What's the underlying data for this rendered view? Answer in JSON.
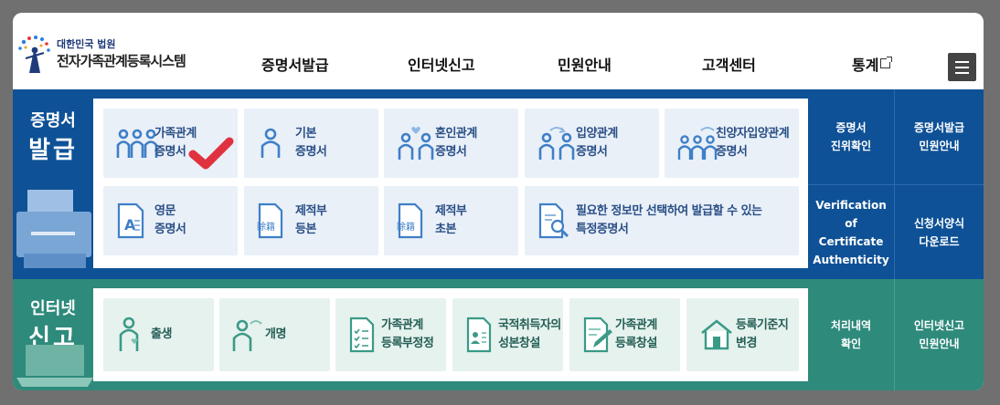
{
  "header": {
    "logo_subtitle": "대한민국 법원",
    "logo_title": "전자가족관계등록시스템",
    "nav": [
      "증명서발급",
      "인터넷신고",
      "민원안내",
      "고객센터",
      "통계"
    ]
  },
  "certificates": {
    "title_small": "증명서",
    "title_big": "발급",
    "cards": [
      {
        "line1": "가족관계",
        "line2": "증명서",
        "icon": "family-icon"
      },
      {
        "line1": "기본",
        "line2": "증명서",
        "icon": "person-icon"
      },
      {
        "line1": "혼인관계",
        "line2": "증명서",
        "icon": "couple-heart-icon"
      },
      {
        "line1": "입양관계",
        "line2": "증명서",
        "icon": "couple-arrows-icon"
      },
      {
        "line1": "친양자입양관계",
        "line2": "증명서",
        "icon": "family-arrows-icon"
      },
      {
        "line1": "영문",
        "line2": "증명서",
        "icon": "english-doc-icon"
      },
      {
        "line1": "제적부",
        "line2": "등본",
        "icon": "register-doc-icon"
      },
      {
        "line1": "제적부",
        "line2": "초본",
        "icon": "register-doc-icon"
      },
      {
        "line1": "필요한 정보만 선택하여 발급할 수 있는",
        "line2": "특정증명서",
        "icon": "search-doc-icon"
      }
    ],
    "side_links": [
      {
        "line1": "증명서",
        "line2": "진위확인"
      },
      {
        "line1": "증명서발급",
        "line2": "민원안내"
      },
      {
        "line1": "Verification of",
        "line2": "Certificate",
        "line3": "Authenticity"
      },
      {
        "line1": "신청서양식",
        "line2": "다운로드"
      }
    ],
    "register_glyph": "除籍"
  },
  "reports": {
    "title_small": "인터넷",
    "title_big": "신고",
    "cards": [
      {
        "line1": "출생",
        "line2": "",
        "icon": "birth-icon"
      },
      {
        "line1": "개명",
        "line2": "",
        "icon": "rename-icon"
      },
      {
        "line1": "가족관계",
        "line2": "등록부정정",
        "icon": "checklist-doc-icon"
      },
      {
        "line1": "국적취득자의",
        "line2": "성본창설",
        "icon": "id-doc-icon"
      },
      {
        "line1": "가족관계",
        "line2": "등록창설",
        "icon": "edit-doc-icon"
      },
      {
        "line1": "등록기준지",
        "line2": "변경",
        "icon": "house-icon"
      }
    ],
    "side_links": [
      {
        "line1": "처리내역",
        "line2": "확인"
      },
      {
        "line1": "인터넷신고",
        "line2": "민원안내"
      }
    ]
  },
  "colors": {
    "cert_section": "#0e5196",
    "report_section": "#2e8a7b",
    "icon_blue": "#3f7fc7",
    "icon_green": "#3a9a86",
    "check_red": "#e0313f"
  }
}
